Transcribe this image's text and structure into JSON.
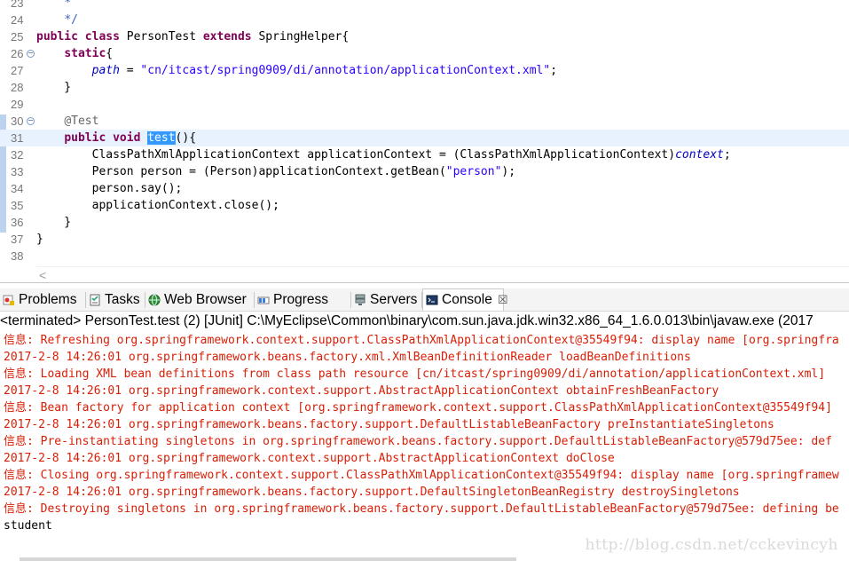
{
  "editor": {
    "lines": [
      {
        "num": "23",
        "parts": [
          {
            "t": "    ",
            "c": ""
          },
          {
            "t": "*",
            "c": "cmt"
          }
        ]
      },
      {
        "num": "24",
        "parts": [
          {
            "t": "    ",
            "c": ""
          },
          {
            "t": "*/",
            "c": "cmt"
          }
        ]
      },
      {
        "num": "25",
        "parts": [
          {
            "t": "public class",
            "c": "kw"
          },
          {
            "t": " PersonTest ",
            "c": ""
          },
          {
            "t": "extends",
            "c": "kw"
          },
          {
            "t": " SpringHelper{",
            "c": ""
          }
        ]
      },
      {
        "num": "26",
        "fold": "−",
        "parts": [
          {
            "t": "    ",
            "c": ""
          },
          {
            "t": "static",
            "c": "kw"
          },
          {
            "t": "{",
            "c": ""
          }
        ]
      },
      {
        "num": "27",
        "parts": [
          {
            "t": "        ",
            "c": ""
          },
          {
            "t": "path",
            "c": "fld"
          },
          {
            "t": " = ",
            "c": ""
          },
          {
            "t": "\"cn/itcast/spring0909/di/annotation/applicationContext.xml\"",
            "c": "str"
          },
          {
            "t": ";",
            "c": ""
          }
        ]
      },
      {
        "num": "28",
        "parts": [
          {
            "t": "    }",
            "c": ""
          }
        ]
      },
      {
        "num": "29",
        "parts": []
      },
      {
        "num": "30",
        "fold": "−",
        "parts": [
          {
            "t": "    ",
            "c": ""
          },
          {
            "t": "@Test",
            "c": "ann"
          }
        ]
      },
      {
        "num": "31",
        "current": true,
        "parts": [
          {
            "t": "    ",
            "c": ""
          },
          {
            "t": "public void",
            "c": "kw"
          },
          {
            "t": " ",
            "c": ""
          },
          {
            "t": "test",
            "c": "sel"
          },
          {
            "t": "(){",
            "c": ""
          }
        ]
      },
      {
        "num": "32",
        "parts": [
          {
            "t": "        ClassPathXmlApplicationContext applicationContext = (ClassPathXmlApplicationContext)",
            "c": ""
          },
          {
            "t": "context",
            "c": "fld"
          },
          {
            "t": ";",
            "c": ""
          }
        ]
      },
      {
        "num": "33",
        "parts": [
          {
            "t": "        Person person = (Person)applicationContext.getBean(",
            "c": ""
          },
          {
            "t": "\"person\"",
            "c": "str"
          },
          {
            "t": ");",
            "c": ""
          }
        ]
      },
      {
        "num": "34",
        "parts": [
          {
            "t": "        person.say();",
            "c": ""
          }
        ]
      },
      {
        "num": "35",
        "parts": [
          {
            "t": "        applicationContext.close();",
            "c": ""
          }
        ]
      },
      {
        "num": "36",
        "parts": [
          {
            "t": "    }",
            "c": ""
          }
        ]
      },
      {
        "num": "37",
        "parts": [
          {
            "t": "}",
            "c": ""
          }
        ]
      },
      {
        "num": "38",
        "parts": []
      }
    ],
    "scroll_left_glyph": "<"
  },
  "panel": {
    "tabs": [
      {
        "label": "Problems",
        "icon": "problems-icon"
      },
      {
        "label": "Tasks",
        "icon": "tasks-icon"
      },
      {
        "label": "Web Browser",
        "icon": "globe-icon"
      },
      {
        "label": "Progress",
        "icon": "progress-icon"
      },
      {
        "label": "Servers",
        "icon": "servers-icon"
      },
      {
        "label": "Console",
        "icon": "console-icon",
        "active": true,
        "close": "☒"
      }
    ],
    "console_header": "<terminated> PersonTest.test (2) [JUnit] C:\\MyEclipse\\Common\\binary\\com.sun.java.jdk.win32.x86_64_1.6.0.013\\bin\\javaw.exe (2017",
    "console_lines": [
      {
        "text": "信息: Refreshing org.springframework.context.support.ClassPathXmlApplicationContext@35549f94: display name [org.springfra",
        "red": true
      },
      {
        "text": "2017-2-8 14:26:01 org.springframework.beans.factory.xml.XmlBeanDefinitionReader loadBeanDefinitions",
        "red": true
      },
      {
        "text": "信息: Loading XML bean definitions from class path resource [cn/itcast/spring0909/di/annotation/applicationContext.xml]",
        "red": true
      },
      {
        "text": "2017-2-8 14:26:01 org.springframework.context.support.AbstractApplicationContext obtainFreshBeanFactory",
        "red": true
      },
      {
        "text": "信息: Bean factory for application context [org.springframework.context.support.ClassPathXmlApplicationContext@35549f94]",
        "red": true
      },
      {
        "text": "2017-2-8 14:26:01 org.springframework.beans.factory.support.DefaultListableBeanFactory preInstantiateSingletons",
        "red": true
      },
      {
        "text": "信息: Pre-instantiating singletons in org.springframework.beans.factory.support.DefaultListableBeanFactory@579d75ee: def",
        "red": true
      },
      {
        "text": "2017-2-8 14:26:01 org.springframework.context.support.AbstractApplicationContext doClose",
        "red": true
      },
      {
        "text": "信息: Closing org.springframework.context.support.ClassPathXmlApplicationContext@35549f94: display name [org.springframew",
        "red": true
      },
      {
        "text": "2017-2-8 14:26:01 org.springframework.beans.factory.support.DefaultSingletonBeanRegistry destroySingletons",
        "red": true
      },
      {
        "text": "信息: Destroying singletons in org.springframework.beans.factory.support.DefaultListableBeanFactory@579d75ee: defining be",
        "red": true
      },
      {
        "text": "student",
        "red": false
      }
    ],
    "watermark": "http://blog.csdn.net/cckevincyh"
  }
}
